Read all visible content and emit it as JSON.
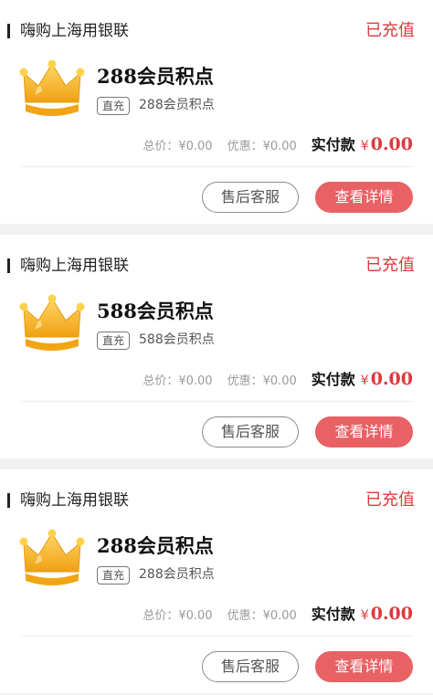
{
  "orders": [
    {
      "shop": "嗨购上海用银联",
      "status": "已充值",
      "product_icon": "crown-icon",
      "title": "288会员积点",
      "tag": "直充",
      "subtitle": "288会员积点",
      "total_price": "总价：¥0.00",
      "discount": "优惠：¥0.00",
      "paid_label": "实付款",
      "paid_currency": "¥",
      "paid_amount": "0.00",
      "after_sales_label": "售后客服",
      "detail_label": "查看详情"
    },
    {
      "shop": "嗨购上海用银联",
      "status": "已充值",
      "product_icon": "crown-icon",
      "title": "588会员积点",
      "tag": "直充",
      "subtitle": "588会员积点",
      "total_price": "总价：¥0.00",
      "discount": "优惠：¥0.00",
      "paid_label": "实付款",
      "paid_currency": "¥",
      "paid_amount": "0.00",
      "after_sales_label": "售后客服",
      "detail_label": "查看详情"
    },
    {
      "shop": "嗨购上海用银联",
      "status": "已充值",
      "product_icon": "crown-icon",
      "title": "288会员积点",
      "tag": "直充",
      "subtitle": "288会员积点",
      "total_price": "总价：¥0.00",
      "discount": "优惠：¥0.00",
      "paid_label": "实付款",
      "paid_currency": "¥",
      "paid_amount": "0.00",
      "after_sales_label": "售后客服",
      "detail_label": "查看详情"
    }
  ],
  "colors": {
    "accent": "#e0383d",
    "button": "#e86165",
    "crown_gold": "#f5b11f"
  }
}
